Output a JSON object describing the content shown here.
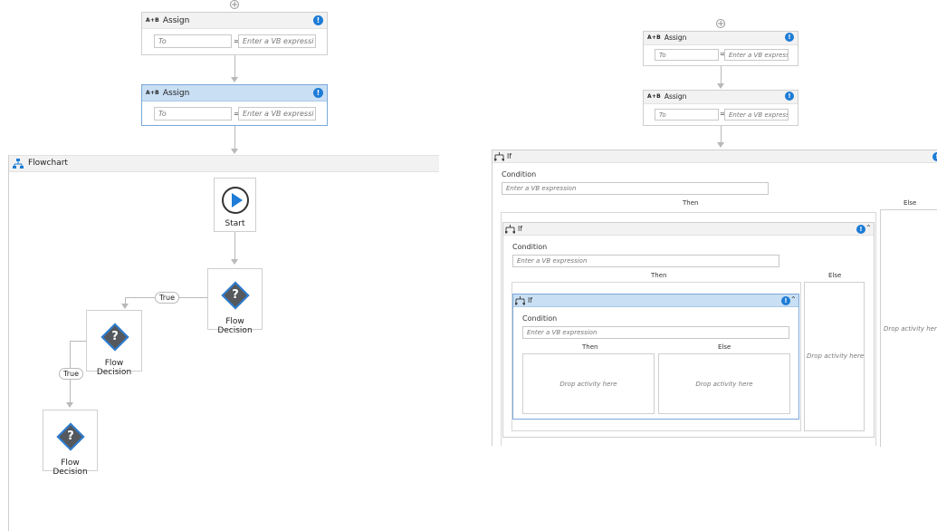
{
  "left": {
    "assign1": {
      "title": "Assign",
      "ab": "A+B",
      "to_placeholder": "To",
      "eq": "=",
      "expr_placeholder": "Enter a VB expressi",
      "info": "!"
    },
    "assign2": {
      "title": "Assign",
      "ab": "A+B",
      "to_placeholder": "To",
      "eq": "=",
      "expr_placeholder": "Enter a VB expressi",
      "info": "!"
    },
    "flowchart": {
      "title": "Flowchart",
      "start_label": "Start",
      "decision1": "Flow Decision",
      "decision2": "Flow Decision",
      "decision3": "Flow Decision",
      "true1": "True",
      "true2": "True",
      "q": "?"
    }
  },
  "right": {
    "assign1": {
      "title": "Assign",
      "ab": "A+B",
      "to_placeholder": "To",
      "eq": "=",
      "expr_placeholder": "Enter a VB expressi",
      "info": "!"
    },
    "assign2": {
      "title": "Assign",
      "ab": "A+B",
      "to_placeholder": "To",
      "eq": "=",
      "expr_placeholder": "Enter a VB expressi",
      "info": "!"
    },
    "if_outer": {
      "title": "If",
      "condition_label": "Condition",
      "condition_placeholder": "Enter a VB expression",
      "then": "Then",
      "else": "Else",
      "drop": "Drop activity here",
      "info": "!"
    },
    "if_mid": {
      "title": "If",
      "condition_label": "Condition",
      "condition_placeholder": "Enter a VB expression",
      "then": "Then",
      "else": "Else",
      "drop": "Drop activity here",
      "info": "!",
      "collapse": "⌃"
    },
    "if_inner": {
      "title": "If",
      "condition_label": "Condition",
      "condition_placeholder": "Enter a VB expression",
      "then": "Then",
      "else": "Else",
      "drop_then": "Drop activity here",
      "drop_else": "Drop activity here",
      "info": "!",
      "collapse": "⌃"
    }
  }
}
